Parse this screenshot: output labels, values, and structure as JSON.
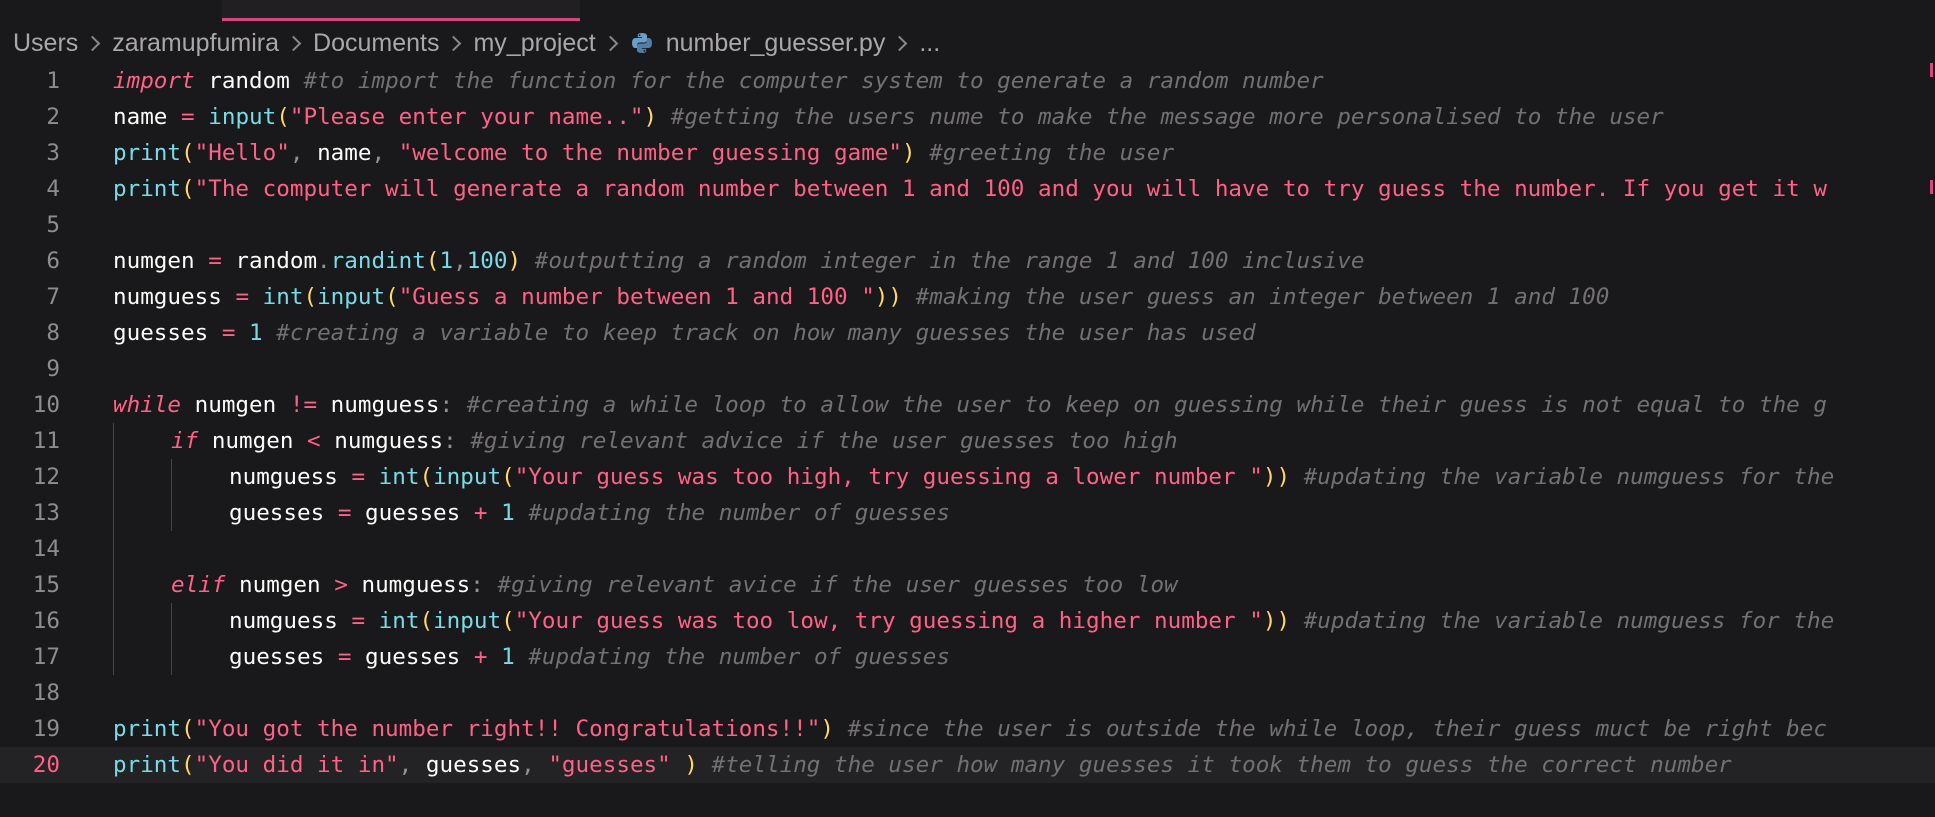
{
  "breadcrumb": {
    "items": [
      "Users",
      "zaramupfumira",
      "Documents",
      "my_project"
    ],
    "file": "number_guesser.py",
    "ellipsis": "...",
    "file_icon": "python-icon"
  },
  "editor": {
    "current_line": 20,
    "lines": [
      {
        "n": "1",
        "indent": 0,
        "tokens": [
          [
            "kw",
            "import"
          ],
          [
            "var",
            " random "
          ],
          [
            "cm",
            "#to import the function for the computer system to generate a random number"
          ]
        ]
      },
      {
        "n": "2",
        "indent": 0,
        "tokens": [
          [
            "var",
            "name "
          ],
          [
            "op",
            "="
          ],
          [
            "var",
            " "
          ],
          [
            "fn",
            "input"
          ],
          [
            "br",
            "("
          ],
          [
            "str",
            "\"Please enter your name..\""
          ],
          [
            "br",
            ")"
          ],
          [
            "var",
            " "
          ],
          [
            "cm",
            "#getting the users nume to make the message more personalised to the user"
          ]
        ]
      },
      {
        "n": "3",
        "indent": 0,
        "tokens": [
          [
            "fn",
            "print"
          ],
          [
            "br",
            "("
          ],
          [
            "str",
            "\"Hello\""
          ],
          [
            "p",
            ", "
          ],
          [
            "var",
            "name"
          ],
          [
            "p",
            ", "
          ],
          [
            "str",
            "\"welcome to the number guessing game\""
          ],
          [
            "br",
            ")"
          ],
          [
            "var",
            " "
          ],
          [
            "cm",
            "#greeting the user"
          ]
        ]
      },
      {
        "n": "4",
        "indent": 0,
        "tokens": [
          [
            "fn",
            "print"
          ],
          [
            "br",
            "("
          ],
          [
            "str",
            "\"The computer will generate a random number between 1 and 100 and you will have to try guess the number. If you get it w"
          ]
        ]
      },
      {
        "n": "5",
        "indent": 0,
        "tokens": []
      },
      {
        "n": "6",
        "indent": 0,
        "tokens": [
          [
            "var",
            "numgen "
          ],
          [
            "op",
            "="
          ],
          [
            "var",
            " random"
          ],
          [
            "p",
            "."
          ],
          [
            "fn",
            "randint"
          ],
          [
            "br",
            "("
          ],
          [
            "num",
            "1"
          ],
          [
            "p",
            ","
          ],
          [
            "num",
            "100"
          ],
          [
            "br",
            ")"
          ],
          [
            "var",
            " "
          ],
          [
            "cm",
            "#outputting a random integer in the range 1 and 100 inclusive"
          ]
        ]
      },
      {
        "n": "7",
        "indent": 0,
        "tokens": [
          [
            "var",
            "numguess "
          ],
          [
            "op",
            "="
          ],
          [
            "var",
            " "
          ],
          [
            "fn",
            "int"
          ],
          [
            "br",
            "("
          ],
          [
            "fn",
            "input"
          ],
          [
            "br",
            "("
          ],
          [
            "str",
            "\"Guess a number between 1 and 100 \""
          ],
          [
            "br",
            "))"
          ],
          [
            "var",
            " "
          ],
          [
            "cm",
            "#making the user guess an integer between 1 and 100"
          ]
        ]
      },
      {
        "n": "8",
        "indent": 0,
        "tokens": [
          [
            "var",
            "guesses "
          ],
          [
            "op",
            "="
          ],
          [
            "var",
            " "
          ],
          [
            "num",
            "1"
          ],
          [
            "var",
            " "
          ],
          [
            "cm",
            "#creating a variable to keep track on how many guesses the user has used"
          ]
        ]
      },
      {
        "n": "9",
        "indent": 0,
        "tokens": []
      },
      {
        "n": "10",
        "indent": 0,
        "tokens": [
          [
            "kw",
            "while"
          ],
          [
            "var",
            " numgen "
          ],
          [
            "op",
            "!="
          ],
          [
            "var",
            " numguess"
          ],
          [
            "p",
            ":"
          ],
          [
            "var",
            " "
          ],
          [
            "cm",
            "#creating a while loop to allow the user to keep on guessing while their guess is not equal to the g"
          ]
        ]
      },
      {
        "n": "11",
        "indent": 1,
        "tokens": [
          [
            "kw",
            "if"
          ],
          [
            "var",
            " numgen "
          ],
          [
            "op",
            "<"
          ],
          [
            "var",
            " numguess"
          ],
          [
            "p",
            ":"
          ],
          [
            "var",
            " "
          ],
          [
            "cm",
            "#giving relevant advice if the user guesses too high"
          ]
        ]
      },
      {
        "n": "12",
        "indent": 2,
        "tokens": [
          [
            "var",
            "numguess "
          ],
          [
            "op",
            "="
          ],
          [
            "var",
            " "
          ],
          [
            "fn",
            "int"
          ],
          [
            "br",
            "("
          ],
          [
            "fn",
            "input"
          ],
          [
            "br",
            "("
          ],
          [
            "str",
            "\"Your guess was too high, try guessing a lower number \""
          ],
          [
            "br",
            "))"
          ],
          [
            "var",
            " "
          ],
          [
            "cm",
            "#updating the variable numguess for the"
          ]
        ]
      },
      {
        "n": "13",
        "indent": 2,
        "tokens": [
          [
            "var",
            "guesses "
          ],
          [
            "op",
            "="
          ],
          [
            "var",
            " guesses "
          ],
          [
            "op",
            "+"
          ],
          [
            "var",
            " "
          ],
          [
            "num",
            "1"
          ],
          [
            "var",
            " "
          ],
          [
            "cm",
            "#updating the number of guesses"
          ]
        ]
      },
      {
        "n": "14",
        "indent": 1,
        "tokens": []
      },
      {
        "n": "15",
        "indent": 1,
        "tokens": [
          [
            "kw",
            "elif"
          ],
          [
            "var",
            " numgen "
          ],
          [
            "op",
            ">"
          ],
          [
            "var",
            " numguess"
          ],
          [
            "p",
            ":"
          ],
          [
            "var",
            " "
          ],
          [
            "cm",
            "#giving relevant avice if the user guesses too low"
          ]
        ]
      },
      {
        "n": "16",
        "indent": 2,
        "tokens": [
          [
            "var",
            "numguess "
          ],
          [
            "op",
            "="
          ],
          [
            "var",
            " "
          ],
          [
            "fn",
            "int"
          ],
          [
            "br",
            "("
          ],
          [
            "fn",
            "input"
          ],
          [
            "br",
            "("
          ],
          [
            "str",
            "\"Your guess was too low, try guessing a higher number \""
          ],
          [
            "br",
            "))"
          ],
          [
            "var",
            " "
          ],
          [
            "cm",
            "#updating the variable numguess for the"
          ]
        ]
      },
      {
        "n": "17",
        "indent": 2,
        "tokens": [
          [
            "var",
            "guesses "
          ],
          [
            "op",
            "="
          ],
          [
            "var",
            " guesses "
          ],
          [
            "op",
            "+"
          ],
          [
            "var",
            " "
          ],
          [
            "num",
            "1"
          ],
          [
            "var",
            " "
          ],
          [
            "cm",
            "#updating the number of guesses"
          ]
        ]
      },
      {
        "n": "18",
        "indent": 0,
        "tokens": []
      },
      {
        "n": "19",
        "indent": 0,
        "tokens": [
          [
            "fn",
            "print"
          ],
          [
            "br",
            "("
          ],
          [
            "str",
            "\"You got the number right!! Congratulations!!\""
          ],
          [
            "br",
            ")"
          ],
          [
            "var",
            " "
          ],
          [
            "cm",
            "#since the user is outside the while loop, their guess muct be right bec"
          ]
        ]
      },
      {
        "n": "20",
        "indent": 0,
        "tokens": [
          [
            "fn",
            "print"
          ],
          [
            "br",
            "("
          ],
          [
            "str",
            "\"You did it in\""
          ],
          [
            "p",
            ", "
          ],
          [
            "var",
            "guesses"
          ],
          [
            "p",
            ", "
          ],
          [
            "str",
            "\"guesses\""
          ],
          [
            "var",
            " "
          ],
          [
            "br",
            ")"
          ],
          [
            "var",
            " "
          ],
          [
            "cm",
            "#telling the user how many guesses it took them to guess the correct number"
          ]
        ]
      }
    ]
  }
}
